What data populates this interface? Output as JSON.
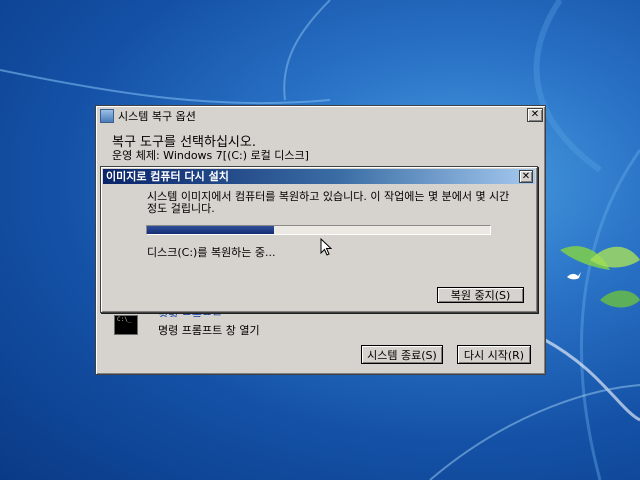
{
  "outer_window": {
    "title": "시스템 복구 옵션",
    "close_glyph": "✕",
    "heading": "복구 도구를 선택하십시오.",
    "os_line": "운영 체제: Windows 7[(C:) 로컬 디스크]",
    "tool_link": "명령 프롬프트",
    "tool_desc": "명령 프롬프트 창 열기",
    "cmd_icon_text": "C:\\_",
    "shutdown_label": "시스템 종료(S)",
    "restart_label": "다시 시작(R)"
  },
  "dialog": {
    "title": "이미지로 컴퓨터 다시 설치",
    "close_glyph": "✕",
    "message": "시스템 이미지에서 컴퓨터를 복원하고 있습니다. 이 작업에는 몇 분에서 몇 시간 정도 걸립니다.",
    "progress_fraction": 0.37,
    "status": "디스크(C:)를 복원하는 중...",
    "stop_label": "복원 중지(S)"
  },
  "colors": {
    "desktop": "#1f5fb6",
    "progress_fill": "#142d75",
    "title_bar_start": "#0a246a",
    "link": "#0b3fa8"
  },
  "icons": [
    "app-icon",
    "close-icon",
    "cmd-prompt-icon",
    "mouse-pointer-icon",
    "bird-icon"
  ]
}
